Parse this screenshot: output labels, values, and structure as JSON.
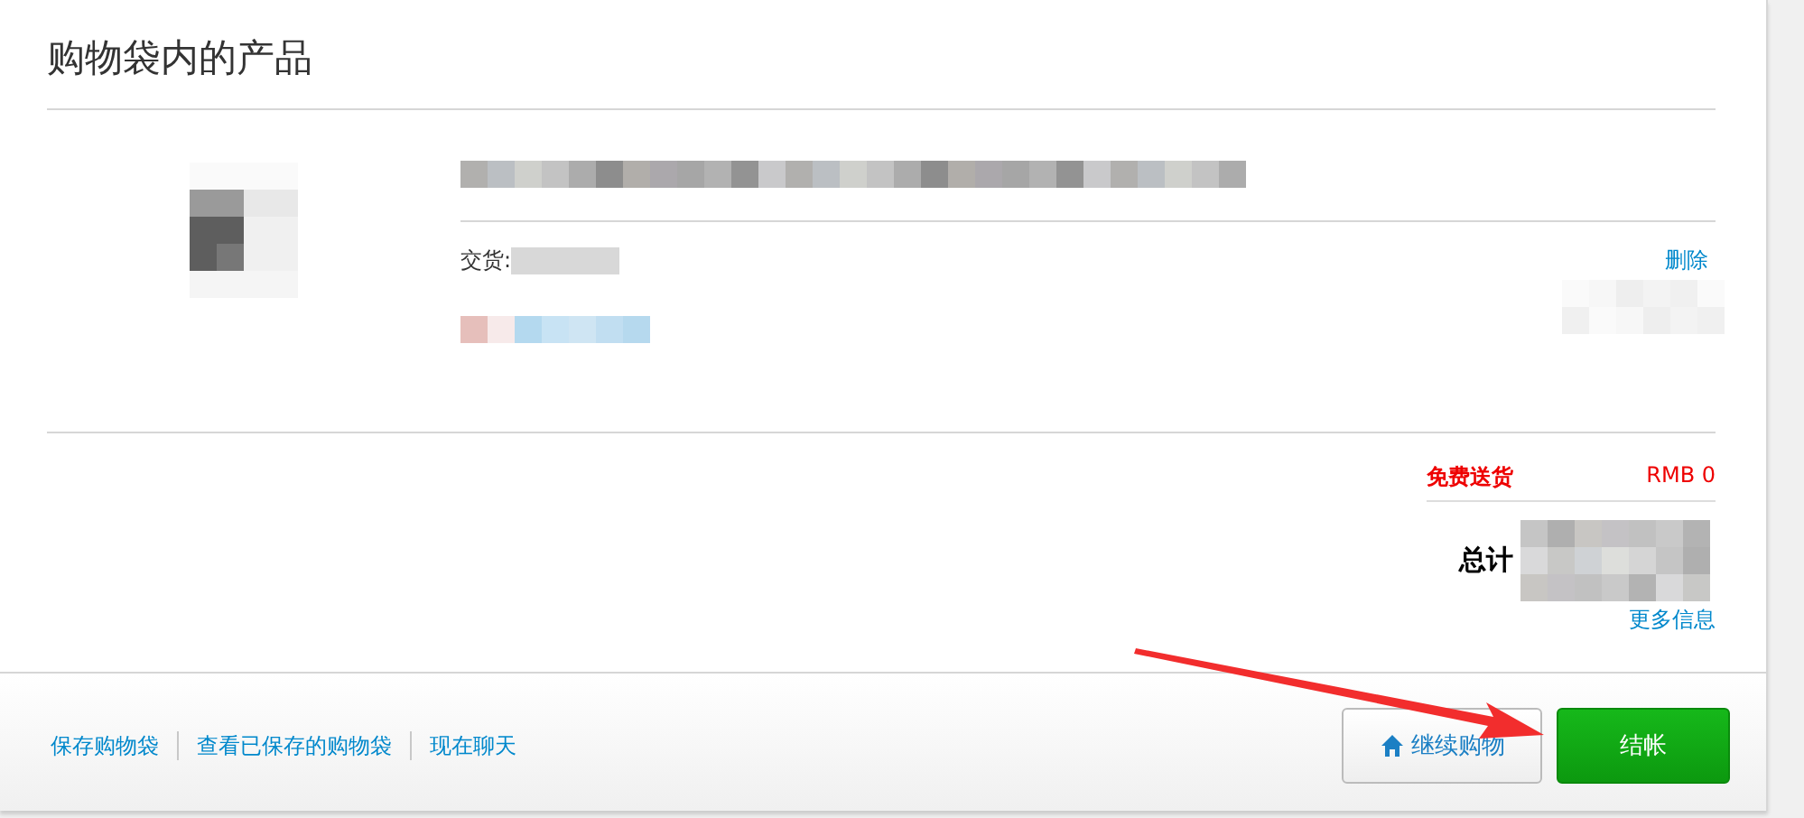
{
  "heading": "购物袋内的产品",
  "item": {
    "delivery": "交货:",
    "remove": "删除"
  },
  "summary": {
    "shipping_label": "免费送货",
    "shipping_value": "RMB 0",
    "total_label": "总计",
    "more_info": "更多信息"
  },
  "footer_links": [
    "保存购物袋",
    "查看已保存的购物袋",
    "现在聊天"
  ],
  "buttons": [
    {
      "kind": "secondary",
      "label": "继续购物"
    },
    {
      "kind": "primary",
      "label": "结帐"
    }
  ]
}
